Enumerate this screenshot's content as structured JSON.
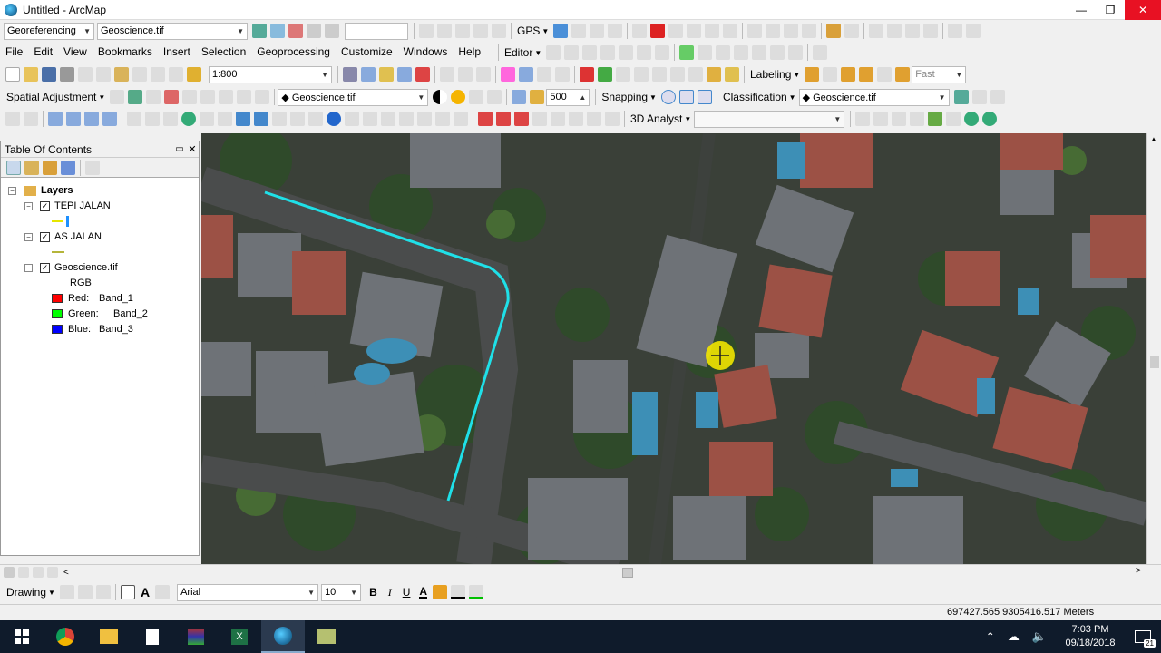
{
  "window": {
    "title": "Untitled - ArcMap",
    "minimize": "—",
    "maximize": "❐",
    "close": "✕"
  },
  "georef_bar": {
    "label": "Georeferencing",
    "layer": "Geoscience.tif",
    "gps": "GPS"
  },
  "menu": [
    "File",
    "Edit",
    "View",
    "Bookmarks",
    "Insert",
    "Selection",
    "Geoprocessing",
    "Customize",
    "Windows",
    "Help"
  ],
  "editor": {
    "label": "Editor"
  },
  "scale": {
    "value": "1:800"
  },
  "labeling": {
    "label": "Labeling",
    "speed": "Fast"
  },
  "spatial_adj": {
    "label": "Spatial Adjustment",
    "layer": "Geoscience.tif",
    "value": "500",
    "snapping": "Snapping",
    "classification": "Classification",
    "class_layer": "Geoscience.tif"
  },
  "analyst": {
    "label": "3D Analyst"
  },
  "toc": {
    "title": "Table Of Contents",
    "root": "Layers",
    "layers": [
      {
        "name": "TEPI JALAN",
        "checked": true,
        "color": "#1e90ff"
      },
      {
        "name": "AS JALAN",
        "checked": true,
        "color": "#b5b53a"
      },
      {
        "name": "Geoscience.tif",
        "checked": true
      }
    ],
    "rgb_label": "RGB",
    "bands": [
      {
        "channel": "Red:",
        "band": "Band_1",
        "color": "#ff0000"
      },
      {
        "channel": "Green:",
        "band": "Band_2",
        "color": "#00ff00"
      },
      {
        "channel": "Blue:",
        "band": "Band_3",
        "color": "#0000ff"
      }
    ]
  },
  "drawing": {
    "label": "Drawing",
    "font": "Arial",
    "size": "10",
    "bold": "B",
    "italic": "I",
    "underline": "U"
  },
  "status": {
    "coords": "697427.565  9305416.517 Meters"
  },
  "taskbar": {
    "time": "7:03 PM",
    "date": "09/18/2018",
    "notifications": "21"
  },
  "colors": {
    "road_line": "#1fe0e8",
    "cursor_highlight": "#f2e600"
  }
}
